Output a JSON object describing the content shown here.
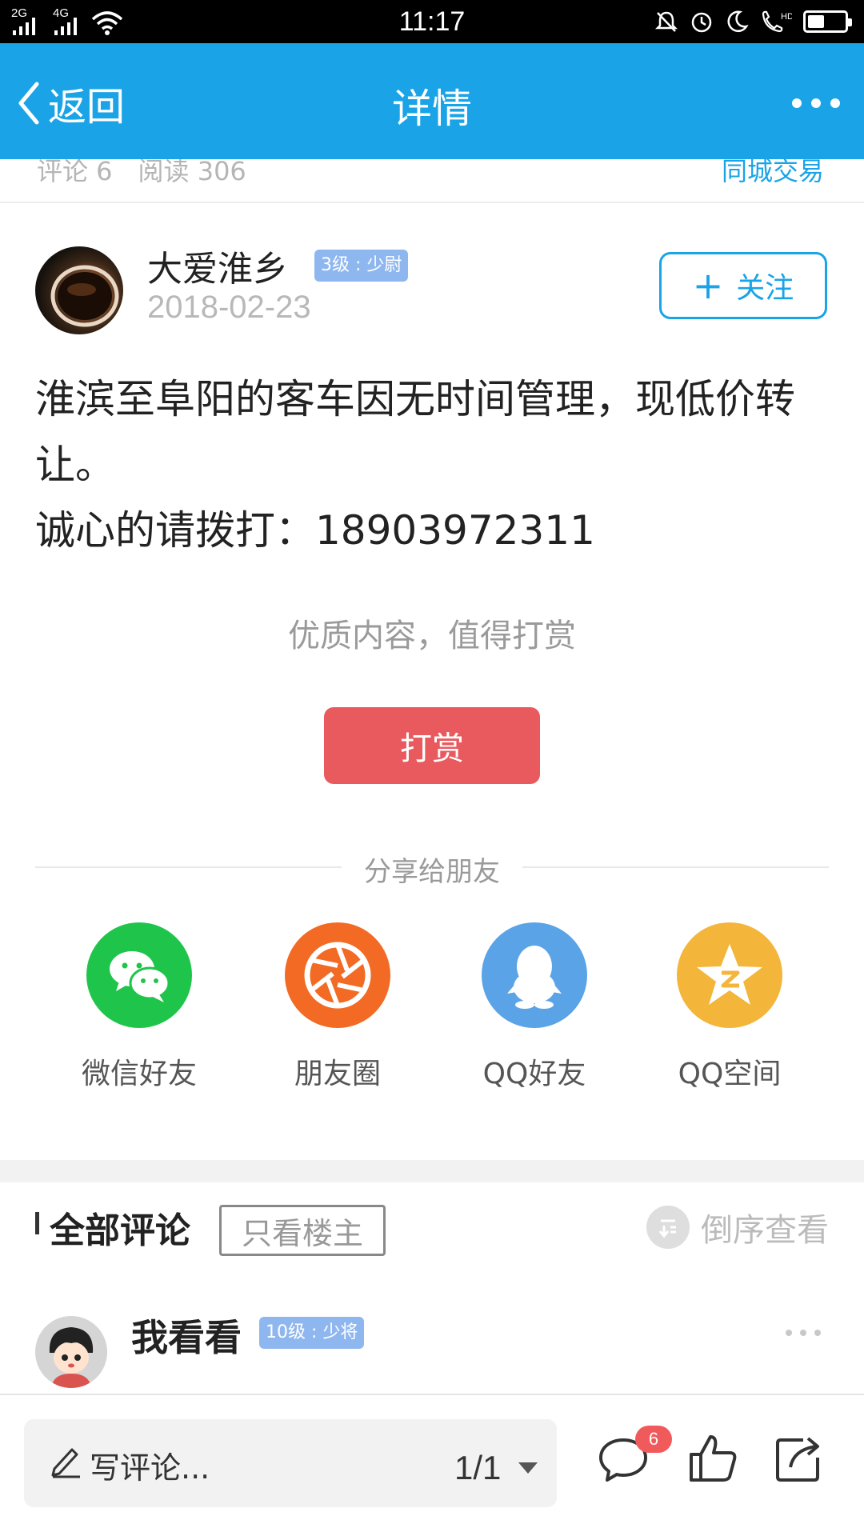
{
  "status_bar": {
    "time": "11:17",
    "signal_1": "2G",
    "signal_2": "4G",
    "battery_level": 0.45,
    "icons": [
      "silent-bell-icon",
      "alarm-icon",
      "moon-icon",
      "hd-call-icon",
      "battery-icon"
    ]
  },
  "nav": {
    "back_label": "返回",
    "title": "详情",
    "more_icon": "more-dots-icon"
  },
  "post_meta": {
    "stats": "评论 6　阅读 306",
    "category": "同城交易"
  },
  "author": {
    "name": "大爱淮乡",
    "level": "3级 : 少尉",
    "date": "2018-02-23",
    "follow_label": "关注"
  },
  "post": {
    "line1": "淮滨至阜阳的客车因无时间管理，现低价转让。",
    "line2": "诚心的请拨打：18903972311"
  },
  "reward": {
    "hint": "优质内容，值得打赏",
    "button": "打赏"
  },
  "share": {
    "title": "分享给朋友",
    "items": [
      {
        "label": "微信好友",
        "icon": "wechat-icon",
        "color": "#1fc54a"
      },
      {
        "label": "朋友圈",
        "icon": "moments-icon",
        "color": "#f26a24"
      },
      {
        "label": "QQ好友",
        "icon": "qq-icon",
        "color": "#5aa3e6"
      },
      {
        "label": "QQ空间",
        "icon": "qzone-icon",
        "color": "#f3b53a"
      }
    ]
  },
  "comments": {
    "title": "全部评论",
    "only_op": "只看楼主",
    "sort": "倒序查看",
    "first": {
      "name": "我看看",
      "level": "10级 : 少将"
    }
  },
  "bottom": {
    "placeholder": "写评论...",
    "page": "1/1",
    "comment_count": "6"
  },
  "colors": {
    "accent": "#1aa3e6",
    "reward": "#e95a5e",
    "badge": "#8fb7ef"
  }
}
